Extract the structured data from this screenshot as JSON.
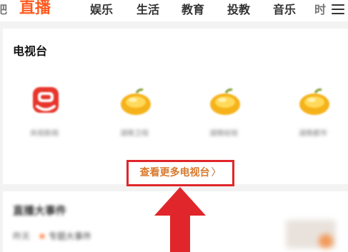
{
  "nav": {
    "partial_left": "吧",
    "tabs": [
      "直播",
      "娱乐",
      "生活",
      "教育",
      "投教",
      "音乐"
    ],
    "partial_right": "时"
  },
  "tv_section": {
    "title": "电视台",
    "channels": [
      {
        "name": "央视新闻",
        "icon": "cctv-logo-icon",
        "color": "#e8352b"
      },
      {
        "name": "湖南卫视",
        "icon": "mango-logo-icon",
        "color": "#f6b21a"
      },
      {
        "name": "湖南经视",
        "icon": "mango-logo-icon",
        "color": "#f6b21a"
      },
      {
        "name": "湖南都市",
        "icon": "mango-logo-icon",
        "color": "#f6b21a"
      }
    ],
    "more_label": "查看更多电视台",
    "more_chevron": "〉"
  },
  "events_section": {
    "title": "直播大事件",
    "first_item_date": "昨天",
    "first_item_text": "专题大事件"
  },
  "colors": {
    "accent": "#ff5a1f",
    "highlight_box": "#e0262a",
    "arrow": "#e0262a"
  }
}
